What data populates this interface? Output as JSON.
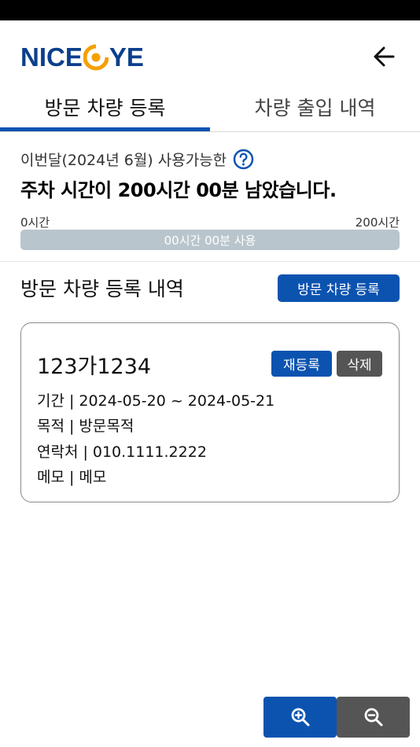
{
  "app": {
    "logo_text_left": "NICE",
    "logo_text_right": "YE",
    "brand_color": "#0c3f8c",
    "accent_color": "#f5a000"
  },
  "header": {
    "back_icon": "arrow-left-icon"
  },
  "tabs": [
    {
      "label": "방문 차량 등록",
      "active": true
    },
    {
      "label": "차량 출입 내역",
      "active": false
    }
  ],
  "usage": {
    "caption": "이번달(2024년 6월) 사용가능한",
    "help_icon": "question-circle-icon",
    "headline": "주차 시간이 200시간 00분 남았습니다.",
    "scale_min": "0시간",
    "scale_max": "200시간",
    "used_label": "00시간 00분 사용",
    "used_fraction": 0
  },
  "section": {
    "title": "방문 차량 등록 내역",
    "register_button": "방문 차량 등록"
  },
  "records": [
    {
      "plate": "123가1234",
      "re_register_label": "재등록",
      "delete_label": "삭제",
      "period_label": "기간",
      "period_value": "2024-05-20 ~ 2024-05-21",
      "purpose_label": "목적",
      "purpose_value": "방문목적",
      "contact_label": "연락처",
      "contact_value": "010.1111.2222",
      "memo_label": "메모",
      "memo_value": "메모"
    }
  ],
  "zoom": {
    "zoom_in_icon": "zoom-in-icon",
    "zoom_out_icon": "zoom-out-icon"
  },
  "colors": {
    "primary": "#0c53b0",
    "secondary": "#555555",
    "progress_track": "#b9c5cc"
  }
}
